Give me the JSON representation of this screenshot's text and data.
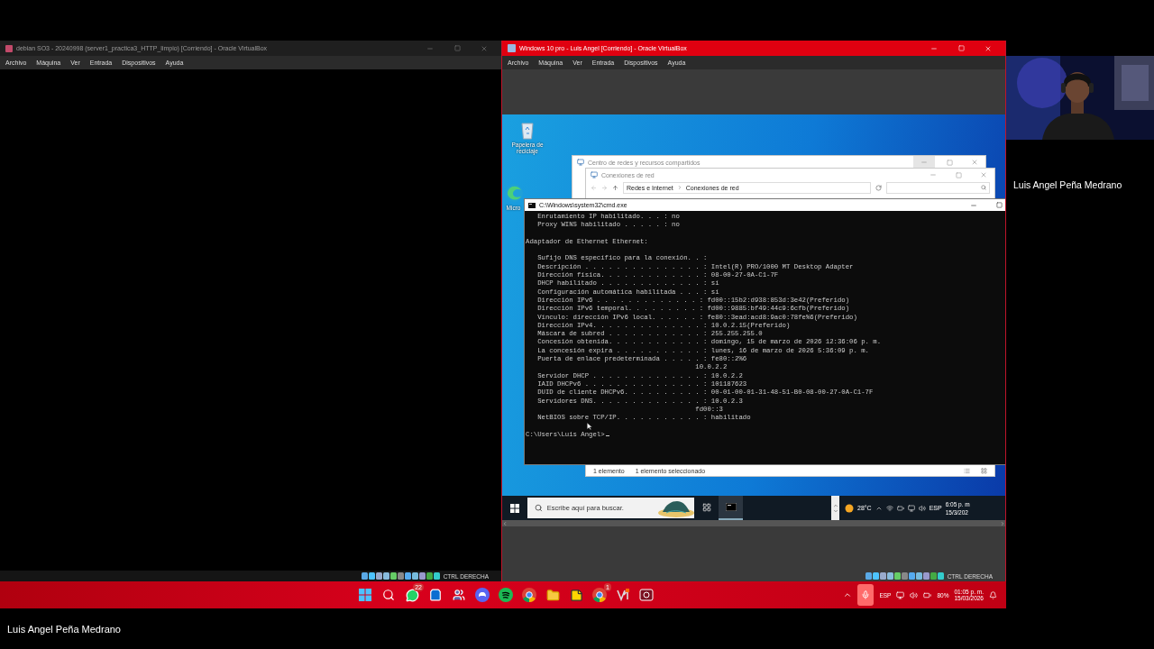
{
  "left_vm": {
    "title": "debian SO3 - 20240998 (server1_practica3_HTTP_limpio) [Corriendo] - Oracle VirtualBox",
    "menu": [
      "Archivo",
      "Máquina",
      "Ver",
      "Entrada",
      "Dispositivos",
      "Ayuda"
    ],
    "status_text": "CTRL DERECHA"
  },
  "right_vm": {
    "title": "Windows 10 pro - Luis Angel [Corriendo] - Oracle VirtualBox",
    "menu": [
      "Archivo",
      "Máquina",
      "Ver",
      "Entrada",
      "Dispositivos",
      "Ayuda"
    ],
    "status_text": "CTRL DERECHA",
    "guest": {
      "desktop_icons": [
        {
          "kind": "recycle",
          "label": "Papelera de reciclaje"
        },
        {
          "kind": "edge",
          "label": "Micro"
        }
      ],
      "network_center_window": {
        "title": "Centro de redes y recursos compartidos"
      },
      "connections_window": {
        "title": "Conexiones de red",
        "breadcrumb": [
          "Redes e Internet",
          "Conexiones de red"
        ],
        "status": [
          "1 elemento",
          "1 elemento seleccionado"
        ]
      },
      "cmd_window": {
        "title": "C:\\Windows\\system32\\cmd.exe",
        "blocks": [
          [
            "   Enrutamiento IP habilitado. . . : no",
            "   Proxy WINS habilitado . . . . . : no"
          ],
          [
            "Adaptador de Ethernet Ethernet:"
          ],
          [
            "   Sufijo DNS específico para la conexión. . :",
            "   Descripción . . . . . . . . . . . . . . . : Intel(R) PRO/1000 MT Desktop Adapter",
            "   Dirección física. . . . . . . . . . . . . : 08-00-27-0A-C1-7F",
            "   DHCP habilitado . . . . . . . . . . . . . : sí",
            "   Configuración automática habilitada . . . : sí",
            "   Dirección IPv6 . . . . . . . . . . . . . : fd00::15b2:d938:853d:3e42(Preferido)",
            "   Dirección IPv6 temporal. . . . . . . . . : fd00::9885:bf49:44c9:6cfb(Preferido)",
            "   Vínculo: dirección IPv6 local. . . . . . : fe80::3ead:acd8:9ac0:78fe%6(Preferido)",
            "   Dirección IPv4. . . . . . . . . . . . . . : 10.0.2.15(Preferido)",
            "   Máscara de subred . . . . . . . . . . . . : 255.255.255.0",
            "   Concesión obtenida. . . . . . . . . . . . : domingo, 15 de marzo de 2026 12:36:06 p. m.",
            "   La concesión expira . . . . . . . . . . . : lunes, 16 de marzo de 2026 5:36:09 p. m.",
            "   Puerta de enlace predeterminada . . . . . : fe80::2%6",
            "                                           10.0.2.2",
            "   Servidor DHCP . . . . . . . . . . . . . . : 10.0.2.2",
            "   IAID DHCPv6 . . . . . . . . . . . . . . . : 101187623",
            "   DUID de cliente DHCPv6. . . . . . . . . . : 00-01-00-01-31-48-51-B0-08-00-27-0A-C1-7F",
            "   Servidores DNS. . . . . . . . . . . . . . : 10.0.2.3",
            "                                           fd00::3",
            "   NetBIOS sobre TCP/IP. . . . . . . . . . . : habilitado"
          ]
        ],
        "prompt": "C:\\Users\\Luis Angel>"
      },
      "taskbar": {
        "search_placeholder": "Escribe aquí para buscar.",
        "weather": "28°C",
        "language": "ESP",
        "time": "6:05 p. m",
        "date": "15/3/202",
        "cmd_selected": true
      }
    }
  },
  "host_taskbar": {
    "apps": [
      {
        "kind": "start"
      },
      {
        "kind": "search"
      },
      {
        "kind": "chat",
        "badge": "22"
      },
      {
        "kind": "store"
      },
      {
        "kind": "team"
      },
      {
        "kind": "game"
      },
      {
        "kind": "music"
      },
      {
        "kind": "browser"
      },
      {
        "kind": "folder"
      },
      {
        "kind": "notes"
      },
      {
        "kind": "browser",
        "badge": "1"
      },
      {
        "kind": "editor"
      },
      {
        "kind": "recorder"
      }
    ],
    "language": "ESP",
    "battery": "80%",
    "time": "01:05 p. m.",
    "date": "15/03/2026",
    "mic_on": true
  },
  "participant": {
    "name": "Luis Angel Peña Medrano"
  },
  "presenter": {
    "name": "Luis Angel Peña Medrano"
  }
}
